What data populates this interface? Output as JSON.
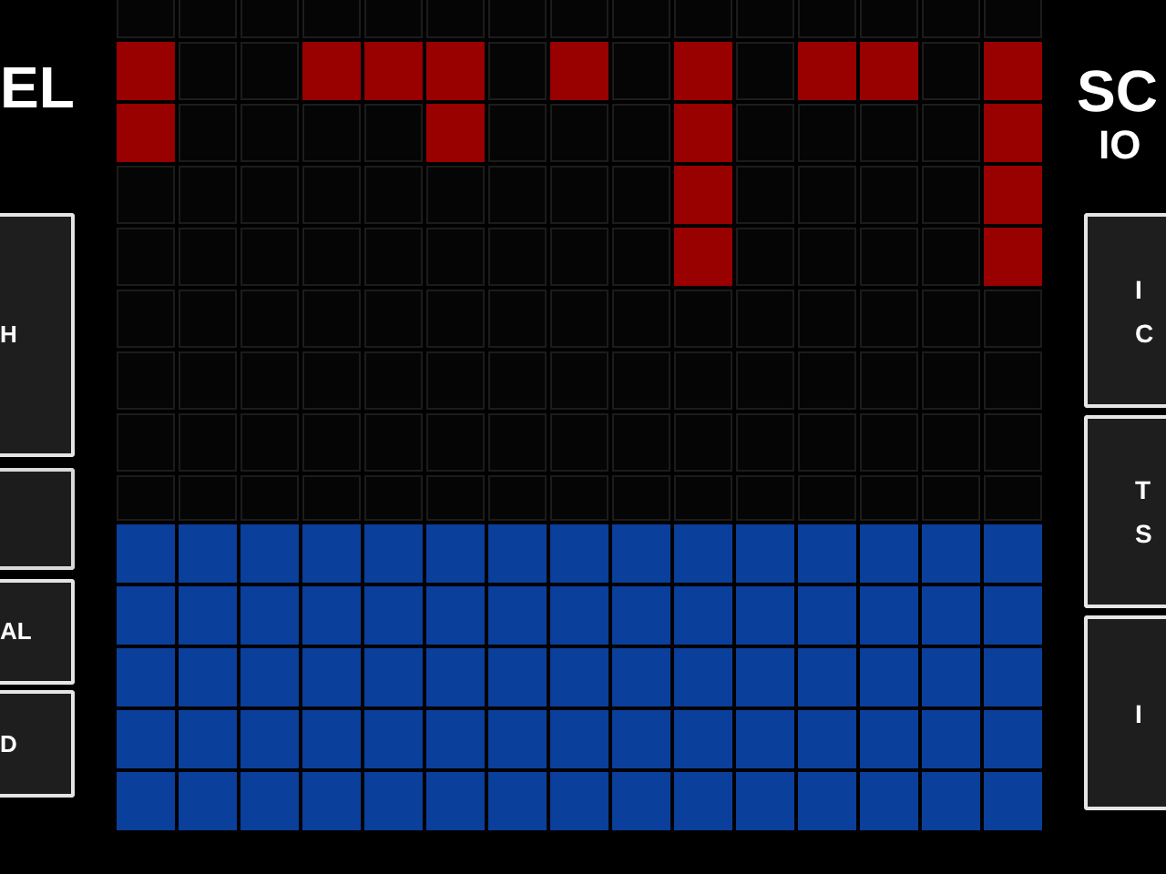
{
  "left_panel": {
    "title": "EL",
    "buttons": [
      {
        "kind": "labeled",
        "lines": [
          "H"
        ]
      },
      {
        "kind": "blank"
      },
      {
        "kind": "labeled",
        "lines": [
          "AL"
        ]
      },
      {
        "kind": "labeled",
        "lines": [
          "D"
        ]
      }
    ]
  },
  "board": {
    "rows": [
      {
        "kind": "field",
        "filled": [
          false,
          false,
          false,
          false,
          false,
          false,
          false,
          false,
          false,
          false,
          false,
          false,
          false,
          false,
          false
        ]
      },
      {
        "kind": "field",
        "filled": [
          true,
          false,
          false,
          true,
          true,
          true,
          false,
          true,
          false,
          true,
          false,
          true,
          true,
          false,
          true
        ]
      },
      {
        "kind": "field",
        "filled": [
          true,
          false,
          false,
          false,
          false,
          true,
          false,
          false,
          false,
          true,
          false,
          false,
          false,
          false,
          true
        ]
      },
      {
        "kind": "field",
        "filled": [
          false,
          false,
          false,
          false,
          false,
          false,
          false,
          false,
          false,
          true,
          false,
          false,
          false,
          false,
          true
        ]
      },
      {
        "kind": "field",
        "filled": [
          false,
          false,
          false,
          false,
          false,
          false,
          false,
          false,
          false,
          true,
          false,
          false,
          false,
          false,
          true
        ]
      },
      {
        "kind": "field",
        "filled": [
          false,
          false,
          false,
          false,
          false,
          false,
          false,
          false,
          false,
          false,
          false,
          false,
          false,
          false,
          false
        ]
      },
      {
        "kind": "field",
        "filled": [
          false,
          false,
          false,
          false,
          false,
          false,
          false,
          false,
          false,
          false,
          false,
          false,
          false,
          false,
          false
        ]
      },
      {
        "kind": "field",
        "filled": [
          false,
          false,
          false,
          false,
          false,
          false,
          false,
          false,
          false,
          false,
          false,
          false,
          false,
          false,
          false
        ]
      },
      {
        "kind": "field",
        "filled": [
          false,
          false,
          false,
          false,
          false,
          false,
          false,
          false,
          false,
          false,
          false,
          false,
          false,
          false,
          false
        ]
      },
      {
        "kind": "base",
        "filled": [
          true,
          true,
          true,
          true,
          true,
          true,
          true,
          true,
          true,
          true,
          true,
          true,
          true,
          true,
          true
        ]
      },
      {
        "kind": "base",
        "filled": [
          true,
          true,
          true,
          true,
          true,
          true,
          true,
          true,
          true,
          true,
          true,
          true,
          true,
          true,
          true
        ]
      },
      {
        "kind": "base",
        "filled": [
          true,
          true,
          true,
          true,
          true,
          true,
          true,
          true,
          true,
          true,
          true,
          true,
          true,
          true,
          true
        ]
      },
      {
        "kind": "base",
        "filled": [
          true,
          true,
          true,
          true,
          true,
          true,
          true,
          true,
          true,
          true,
          true,
          true,
          true,
          true,
          true
        ]
      },
      {
        "kind": "base",
        "filled": [
          true,
          true,
          true,
          true,
          true,
          true,
          true,
          true,
          true,
          true,
          true,
          true,
          true,
          true,
          true
        ]
      }
    ]
  },
  "right_panel": {
    "title": "SC",
    "score": "IO",
    "buttons": [
      {
        "lines": [
          "I",
          "C"
        ]
      },
      {
        "lines": [
          "T",
          "S"
        ]
      },
      {
        "lines": [
          "I"
        ]
      }
    ]
  }
}
